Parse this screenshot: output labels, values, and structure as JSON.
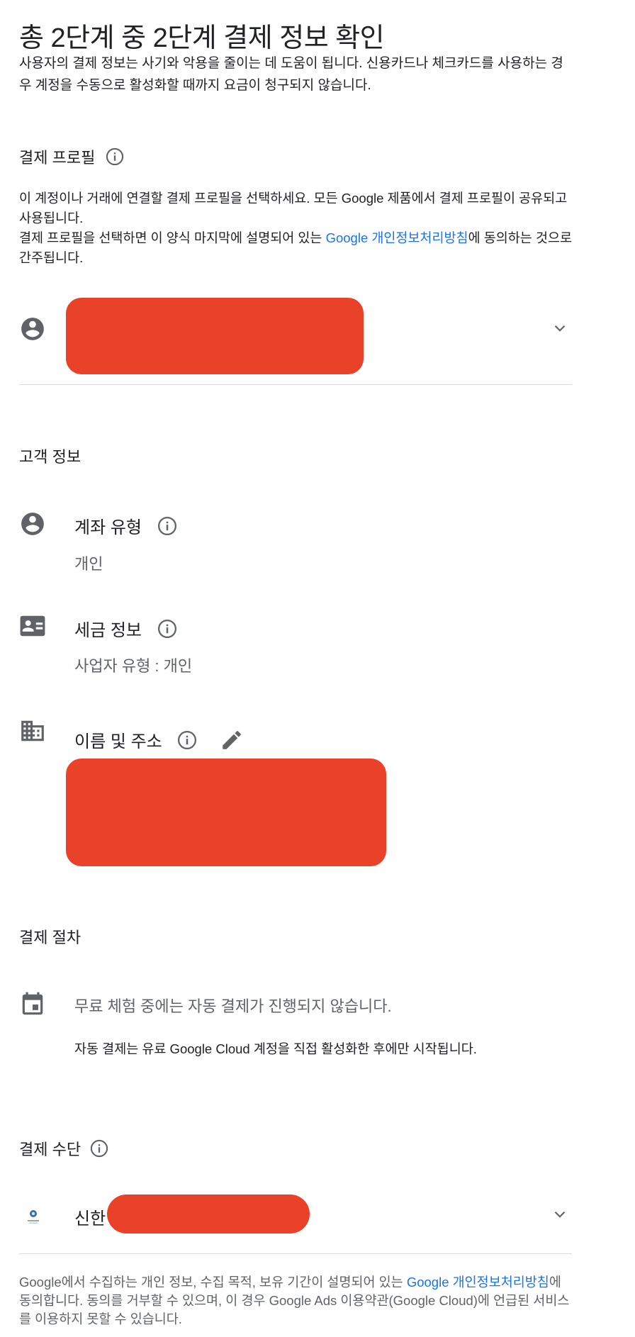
{
  "header": {
    "title": "총 2단계 중 2단계 결제 정보 확인",
    "intro": "사용자의 결제 정보는 사기와 악용을 줄이는 데 도움이 됩니다. 신용카드나 체크카드를 사용하는 경우 계정을 수동으로 활성화할 때까지 요금이 청구되지 않습니다."
  },
  "payments_profile": {
    "title": "결제 프로필",
    "desc_line1": "이 계정이나 거래에 연결할 결제 프로필을 선택하세요. 모든 Google 제품에서 결제 프로필이 공유되고 사용됩니다.",
    "desc_line2_pre": "결제 프로필을 선택하면 이 양식 마지막에 설명되어 있는 ",
    "desc_line2_link": "Google 개인정보처리방침",
    "desc_line2_post": "에 동의하는 것으로 간주됩니다."
  },
  "customer_info": {
    "title": "고객 정보",
    "account_type_label": "계좌 유형",
    "account_type_value": "개인",
    "tax_info_label": "세금 정보",
    "tax_info_value": "사업자 유형 : 개인",
    "name_address_label": "이름 및 주소"
  },
  "payment_process": {
    "title": "결제 절차",
    "line1": "무료 체험 중에는 자동 결제가 진행되지 않습니다.",
    "line2": "자동 결제는 유료 Google Cloud 계정을 직접 활성화한 후에만 시작됩니다."
  },
  "payment_method": {
    "title": "결제 수단",
    "card_name": "신한"
  },
  "footer": {
    "pre": "Google에서 수집하는 개인 정보, 수집 목적, 보유 기간이 설명되어 있는 ",
    "link": "Google 개인정보처리방침",
    "post": "에 동의합니다. 동의를 거부할 수 있으며, 이 경우 Google Ads 이용약관(Google Cloud)에 언급된 서비스를 이용하지 못할 수 있습니다."
  },
  "colors": {
    "redaction": "#ea4129",
    "link": "#1a73e8",
    "icon": "#5f6368"
  }
}
